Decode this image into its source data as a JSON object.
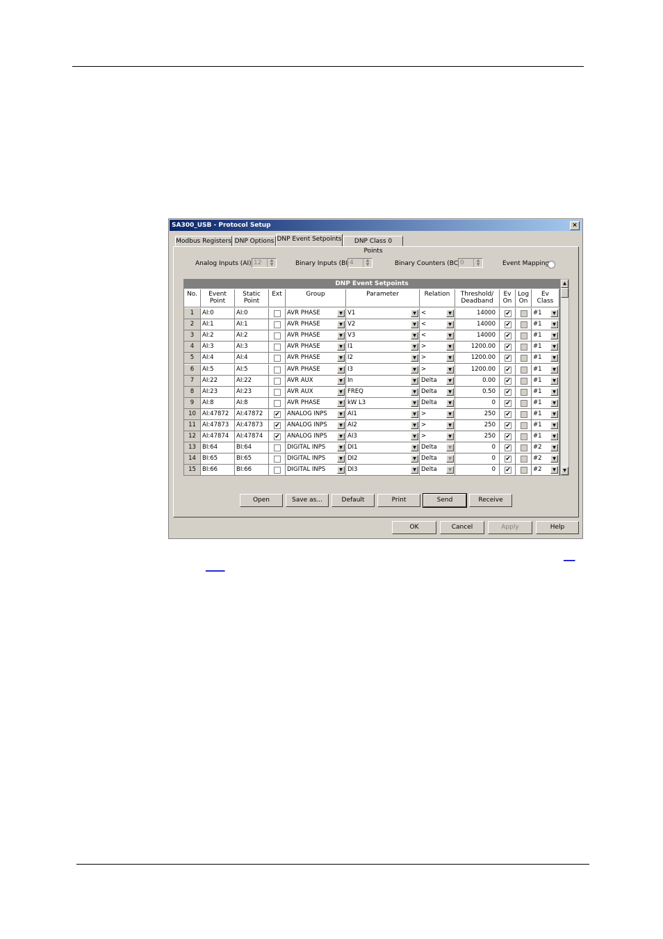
{
  "page": {
    "link1": "___",
    "link2": "_____"
  },
  "window": {
    "title": "SA300_USB - Protocol Setup",
    "close_glyph": "×"
  },
  "tabs": [
    "Modbus Registers",
    "DNP Options",
    "DNP Event Setpoints",
    "DNP Class 0 Points"
  ],
  "controls": {
    "analog_inputs_label": "Analog Inputs (AI)",
    "analog_inputs_value": "12",
    "binary_inputs_label": "Binary Inputs (BI)",
    "binary_inputs_value": "4",
    "binary_counters_label": "Binary Counters (BC)",
    "binary_counters_value": "0",
    "event_mapping_label": "Event Mapping"
  },
  "grid": {
    "title": "DNP Event Setpoints",
    "headers": [
      "No.",
      "Event\nPoint",
      "Static\nPoint",
      "Ext",
      "Group",
      "Parameter",
      "Relation",
      "Threshold/\nDeadband",
      "Ev\nOn",
      "Log\nOn",
      "Ev\nClass"
    ],
    "rows": [
      {
        "no": "1",
        "event": "AI:0",
        "static": "AI:0",
        "ext": false,
        "group": "AVR PHASE",
        "param": "V1",
        "rel": "<",
        "thr": "14000",
        "ev_on": true,
        "cls": "#1"
      },
      {
        "no": "2",
        "event": "AI:1",
        "static": "AI:1",
        "ext": false,
        "group": "AVR PHASE",
        "param": "V2",
        "rel": "<",
        "thr": "14000",
        "ev_on": true,
        "cls": "#1"
      },
      {
        "no": "3",
        "event": "AI:2",
        "static": "AI:2",
        "ext": false,
        "group": "AVR PHASE",
        "param": "V3",
        "rel": "<",
        "thr": "14000",
        "ev_on": true,
        "cls": "#1"
      },
      {
        "no": "4",
        "event": "AI:3",
        "static": "AI:3",
        "ext": false,
        "group": "AVR PHASE",
        "param": "I1",
        "rel": ">",
        "thr": "1200.00",
        "ev_on": true,
        "cls": "#1"
      },
      {
        "no": "5",
        "event": "AI:4",
        "static": "AI:4",
        "ext": false,
        "group": "AVR PHASE",
        "param": "I2",
        "rel": ">",
        "thr": "1200.00",
        "ev_on": true,
        "cls": "#1"
      },
      {
        "no": "6",
        "event": "AI:5",
        "static": "AI:5",
        "ext": false,
        "group": "AVR PHASE",
        "param": "I3",
        "rel": ">",
        "thr": "1200.00",
        "ev_on": true,
        "cls": "#1"
      },
      {
        "no": "7",
        "event": "AI:22",
        "static": "AI:22",
        "ext": false,
        "group": "AVR AUX",
        "param": "In",
        "rel": "Delta",
        "thr": "0.00",
        "ev_on": true,
        "cls": "#1"
      },
      {
        "no": "8",
        "event": "AI:23",
        "static": "AI:23",
        "ext": false,
        "group": "AVR AUX",
        "param": "FREQ",
        "rel": "Delta",
        "thr": "0.50",
        "ev_on": true,
        "cls": "#1"
      },
      {
        "no": "9",
        "event": "AI:8",
        "static": "AI:8",
        "ext": false,
        "group": "AVR PHASE",
        "param": "kW L3",
        "rel": "Delta",
        "thr": "0",
        "ev_on": true,
        "cls": "#1"
      },
      {
        "no": "10",
        "event": "AI:47872",
        "static": "AI:47872",
        "ext": true,
        "group": "ANALOG INPS",
        "param": "AI1",
        "rel": ">",
        "thr": "250",
        "ev_on": true,
        "cls": "#1"
      },
      {
        "no": "11",
        "event": "AI:47873",
        "static": "AI:47873",
        "ext": true,
        "group": "ANALOG INPS",
        "param": "AI2",
        "rel": ">",
        "thr": "250",
        "ev_on": true,
        "cls": "#1"
      },
      {
        "no": "12",
        "event": "AI:47874",
        "static": "AI:47874",
        "ext": true,
        "group": "ANALOG INPS",
        "param": "AI3",
        "rel": ">",
        "thr": "250",
        "ev_on": true,
        "cls": "#1"
      },
      {
        "no": "13",
        "event": "BI:64",
        "static": "BI:64",
        "ext": false,
        "group": "DIGITAL INPS",
        "param": "DI1",
        "rel": "Delta",
        "thr": "0",
        "ev_on": true,
        "cls": "#2"
      },
      {
        "no": "14",
        "event": "BI:65",
        "static": "BI:65",
        "ext": false,
        "group": "DIGITAL INPS",
        "param": "DI2",
        "rel": "Delta",
        "thr": "0",
        "ev_on": true,
        "cls": "#2"
      },
      {
        "no": "15",
        "event": "BI:66",
        "static": "BI:66",
        "ext": false,
        "group": "DIGITAL INPS",
        "param": "DI3",
        "rel": "Delta",
        "thr": "0",
        "ev_on": true,
        "cls": "#2"
      }
    ]
  },
  "buttons": {
    "open": "Open",
    "save_as": "Save as...",
    "default": "Default",
    "print": "Print",
    "send": "Send",
    "receive": "Receive",
    "ok": "OK",
    "cancel": "Cancel",
    "apply": "Apply",
    "help": "Help"
  }
}
